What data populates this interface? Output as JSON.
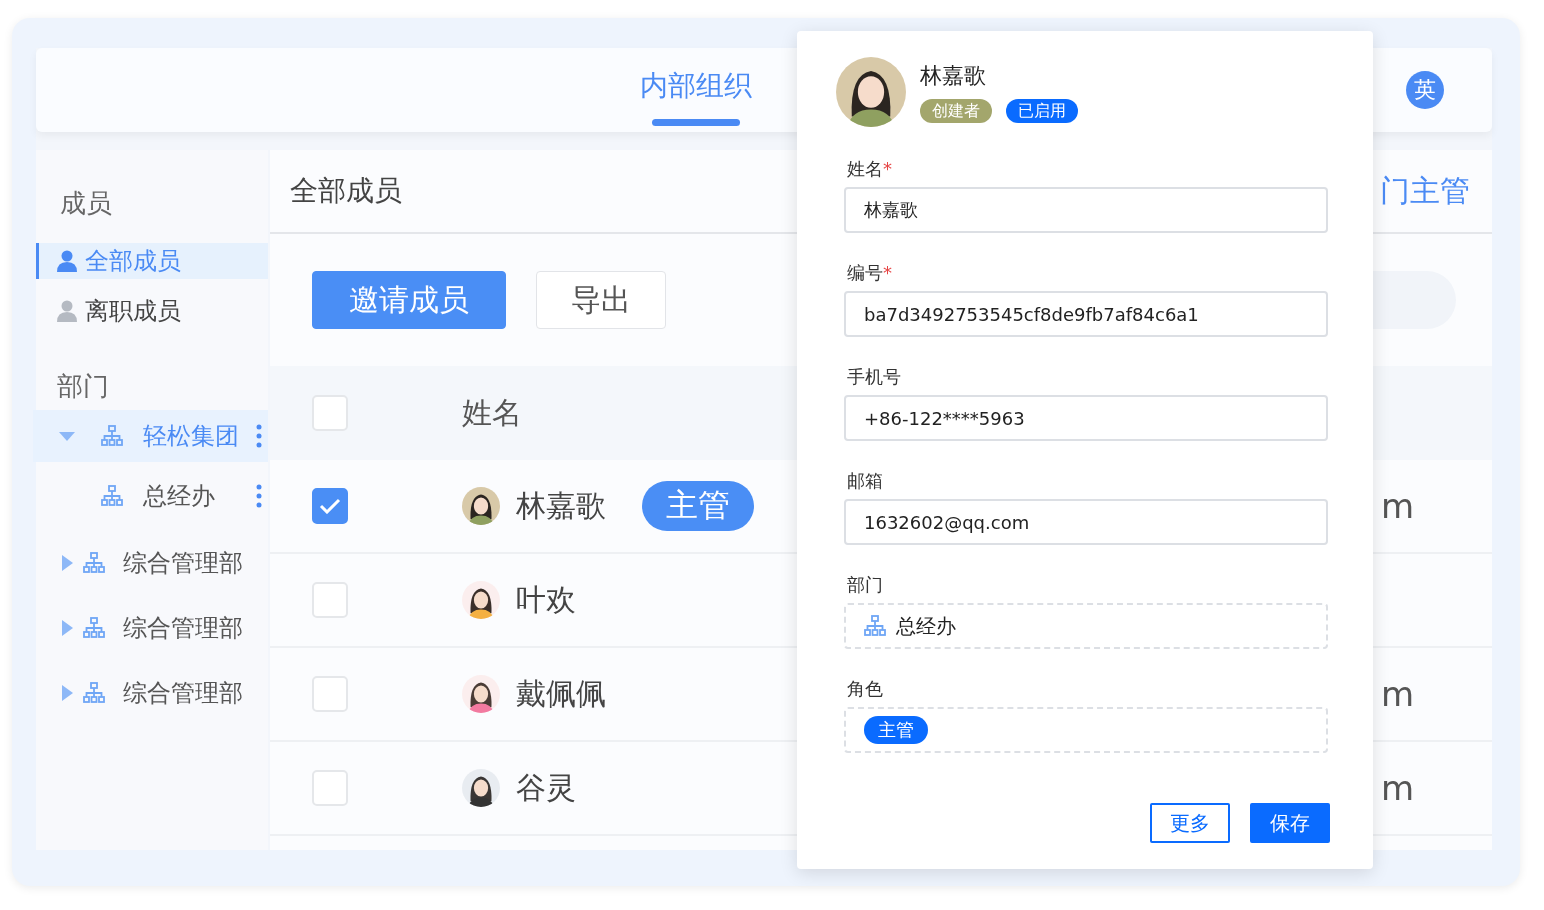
{
  "top_nav": {
    "tabs": [
      {
        "label": "内部组织",
        "selected": true
      }
    ],
    "user_avatar": "英"
  },
  "sidebar": {
    "members_heading": "成员",
    "member_items": [
      {
        "label": "全部成员",
        "selected": true
      },
      {
        "label": "离职成员",
        "selected": false
      }
    ],
    "departments_heading": "部门",
    "departments": [
      {
        "label": "轻松集团",
        "selected": true,
        "expanded": true,
        "show_menu": true,
        "children": [
          {
            "label": "总经办",
            "selected": false,
            "show_menu": true
          }
        ]
      },
      {
        "label": "综合管理部",
        "selected": false,
        "expanded": false,
        "show_menu": false
      },
      {
        "label": "综合管理部",
        "selected": false,
        "expanded": false,
        "show_menu": false
      },
      {
        "label": "综合管理部",
        "selected": false,
        "expanded": false,
        "show_menu": false
      }
    ]
  },
  "main": {
    "title": "全部成员",
    "column_3_heading": "门主管",
    "buttons": [
      {
        "label": "邀请成员",
        "kind": "primary"
      },
      {
        "label": "导出",
        "kind": "default"
      }
    ],
    "table": {
      "header_checked": false,
      "columns": [
        "姓名"
      ],
      "rows": [
        {
          "checked": true,
          "name": "林嘉歌",
          "tag": "主管",
          "column_3": "m"
        },
        {
          "checked": false,
          "name": "叶欢"
        },
        {
          "checked": false,
          "name": "戴佩佩",
          "column_3": "m"
        },
        {
          "checked": false,
          "name": "谷灵",
          "column_3": "m"
        }
      ]
    }
  },
  "dialog": {
    "name": "林嘉歌",
    "badges": [
      {
        "label": "创建者",
        "color": "#a3a66c"
      },
      {
        "label": "已启用",
        "color": "#0a6bff"
      }
    ],
    "fields": [
      {
        "kind": "text",
        "label": "姓名",
        "required_mark": "*",
        "value": "林嘉歌"
      },
      {
        "kind": "text",
        "label": "编号",
        "required_mark": "*",
        "value": "ba7d3492753545cf8de9fb7af84c6a1"
      },
      {
        "kind": "text",
        "label": "手机号",
        "value": "+86-122****5963"
      },
      {
        "kind": "text",
        "label": "邮箱",
        "value": "1632602@qq.com"
      },
      {
        "kind": "department",
        "label": "部门",
        "value": "总经办"
      },
      {
        "kind": "tags",
        "label": "角色",
        "tags": [
          "主管"
        ]
      }
    ],
    "buttons": [
      {
        "label": "更多",
        "kind": "secondary"
      },
      {
        "label": "保存",
        "kind": "primary"
      }
    ]
  }
}
